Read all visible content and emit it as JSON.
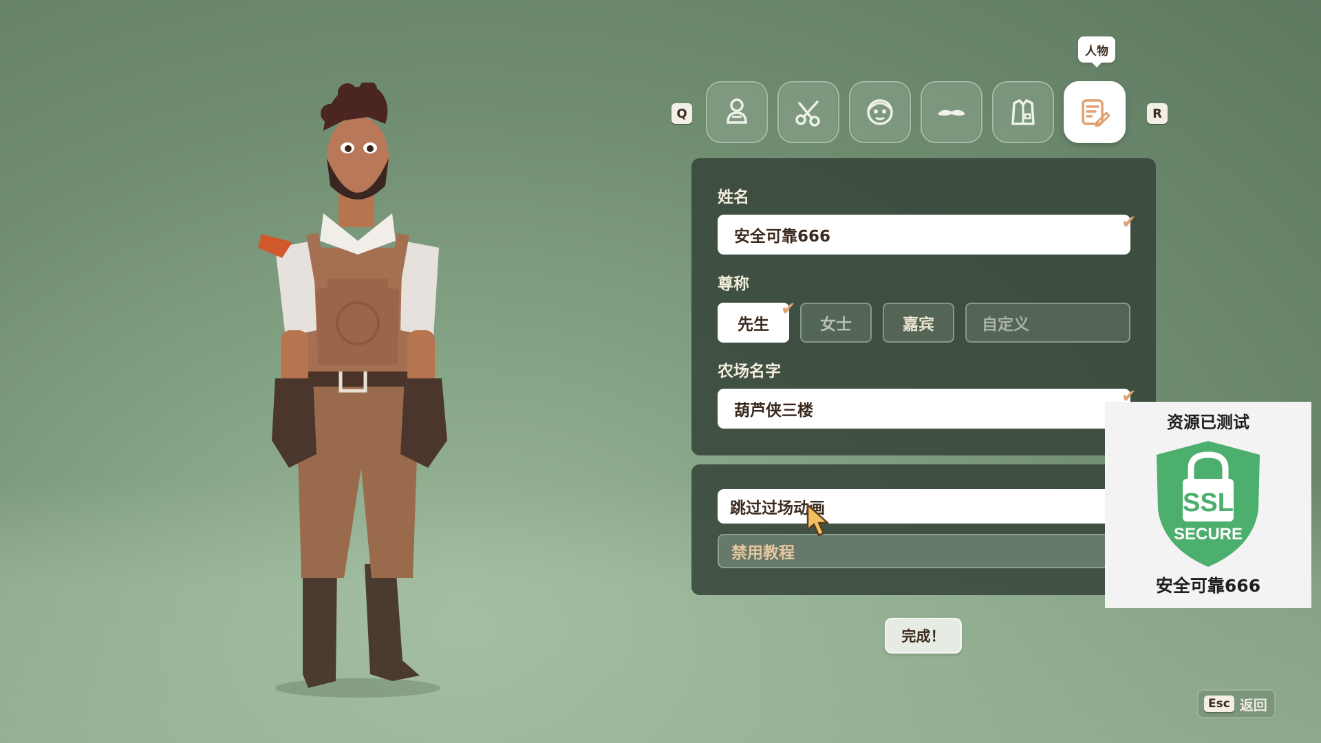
{
  "tabs": {
    "prev_key": "Q",
    "next_key": "R",
    "tooltip": "人物",
    "items": [
      {
        "icon": "body-icon"
      },
      {
        "icon": "scissors-icon"
      },
      {
        "icon": "face-icon"
      },
      {
        "icon": "mustache-icon"
      },
      {
        "icon": "outfit-icon"
      },
      {
        "icon": "edit-profile-icon",
        "active": true
      }
    ]
  },
  "form": {
    "name_label": "姓名",
    "name_value": "安全可靠666",
    "title_label": "尊称",
    "title_options": [
      "先生",
      "女士",
      "嘉宾"
    ],
    "title_selected": "先生",
    "title_custom_placeholder": "自定义",
    "farm_label": "农场名字",
    "farm_value": "葫芦侠三楼"
  },
  "options": {
    "skip_cutscenes": {
      "label": "跳过过场动画",
      "checked": true
    },
    "disable_tutorial": {
      "label": "禁用教程",
      "checked": true
    }
  },
  "done_label": "完成！",
  "ssl_badge": {
    "top_text": "资源已测试",
    "shield_line1": "SSL",
    "shield_line2": "SECURE",
    "bottom_text": "安全可靠666",
    "color": "#4caf6d"
  },
  "esc": {
    "key": "Esc",
    "label": "返回"
  },
  "colors": {
    "accent": "#e0a070",
    "panel": "#37463a",
    "background": "#7a977a"
  }
}
